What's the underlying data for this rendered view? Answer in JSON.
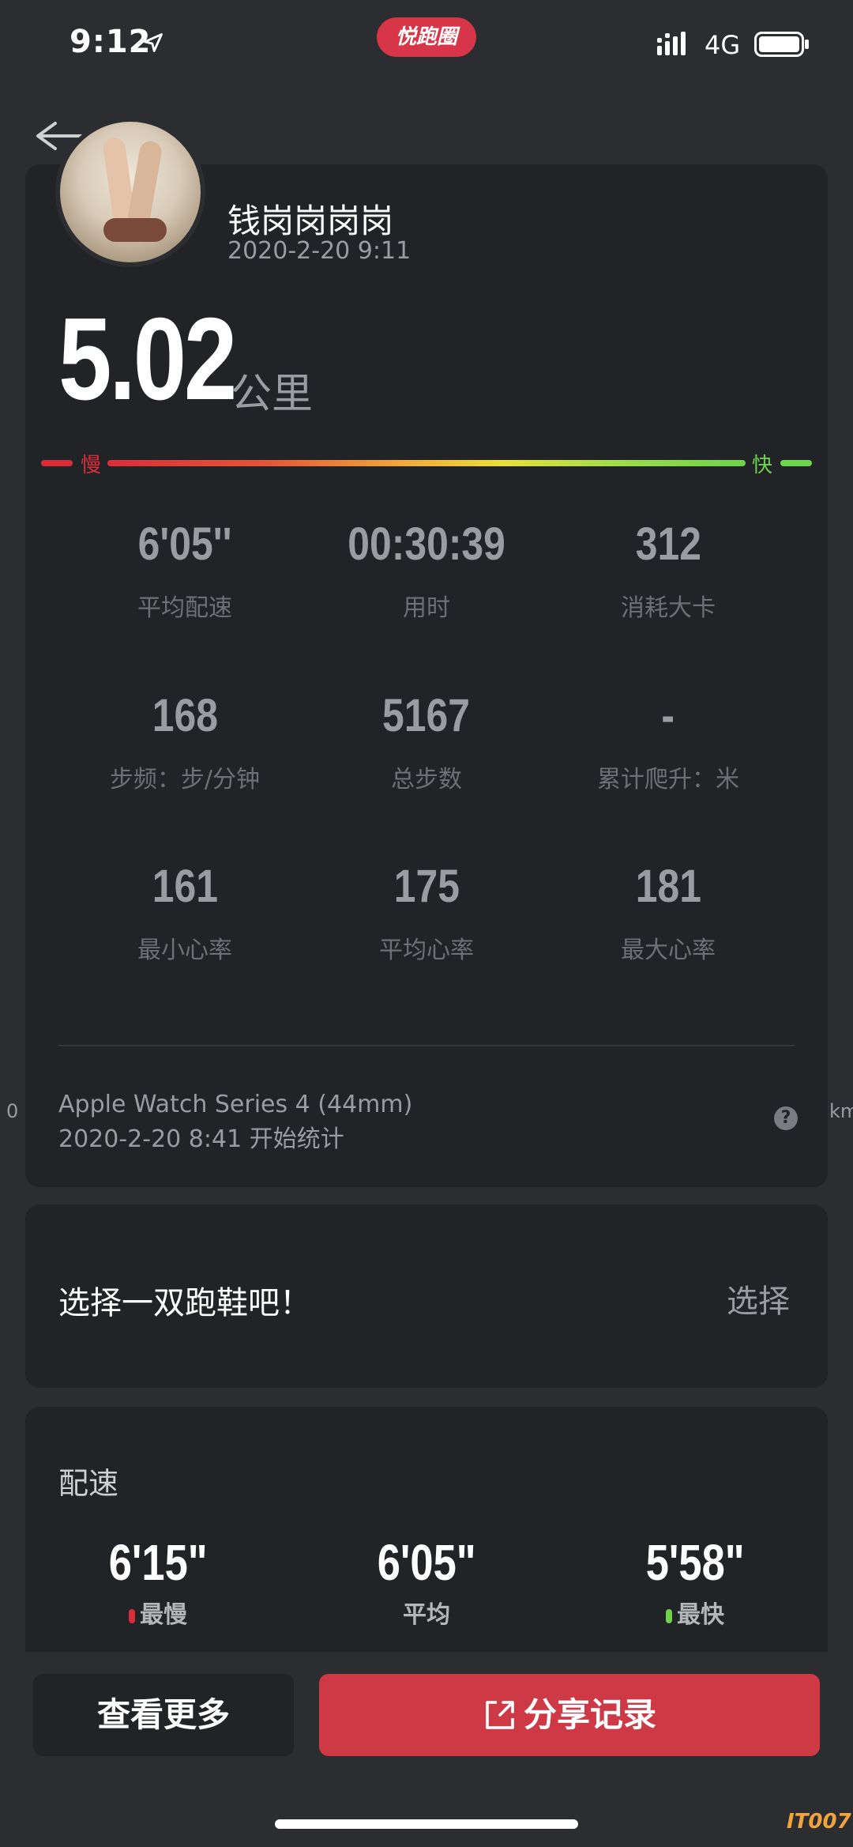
{
  "status_bar": {
    "time": "9:12",
    "brand": "悦跑圈",
    "network": "4G"
  },
  "profile": {
    "username": "钱岗岗岗岗",
    "datetime": "2020-2-20 9:11"
  },
  "summary": {
    "distance": "5.02",
    "distance_unit": "公里"
  },
  "speed_scale": {
    "slow": "慢",
    "fast": "快"
  },
  "stats": [
    {
      "value": "6'05''",
      "label": "平均配速"
    },
    {
      "value": "00:30:39",
      "label": "用时"
    },
    {
      "value": "312",
      "label": "消耗大卡"
    },
    {
      "value": "168",
      "label": "步频：步/分钟"
    },
    {
      "value": "5167",
      "label": "总步数"
    },
    {
      "value": "-",
      "label": "累计爬升：米"
    },
    {
      "value": "161",
      "label": "最小心率"
    },
    {
      "value": "175",
      "label": "平均心率"
    },
    {
      "value": "181",
      "label": "最大心率"
    }
  ],
  "device": {
    "name": "Apple Watch Series 4 (44mm)",
    "start": "2020-2-20 8:41 开始统计",
    "edge_left": "0",
    "edge_right": "km"
  },
  "shoe": {
    "prompt": "选择一双跑鞋吧！",
    "select_label": "选择"
  },
  "pace": {
    "title": "配速",
    "items": [
      {
        "value": "6'15\"",
        "label": "最慢",
        "color": "#d92e3a"
      },
      {
        "value": "6'05\"",
        "label": "平均",
        "color": ""
      },
      {
        "value": "5'58\"",
        "label": "最快",
        "color": "#6ed24c"
      }
    ]
  },
  "actions": {
    "more_label": "查看更多",
    "share_label": "分享记录"
  },
  "watermark": "IT007",
  "colors": {
    "background": "#2b2d31",
    "card": "#212327",
    "accent": "#cd3a46",
    "slow": "#d92e3a",
    "fast": "#6ed24c"
  }
}
